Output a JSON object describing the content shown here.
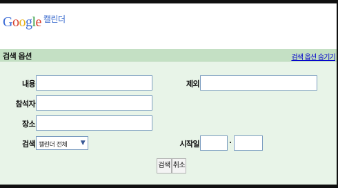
{
  "logo": {
    "letters": [
      {
        "ch": "G",
        "color": "#3b6bd6"
      },
      {
        "ch": "o",
        "color": "#d84030"
      },
      {
        "ch": "o",
        "color": "#e8b018"
      },
      {
        "ch": "g",
        "color": "#3b6bd6"
      },
      {
        "ch": "l",
        "color": "#2f9a3c"
      },
      {
        "ch": "e",
        "color": "#d84030"
      }
    ],
    "product": "캘린더"
  },
  "section": {
    "title": "검색 옵션",
    "hide_link": "검색 옵션 숨기기"
  },
  "form": {
    "content_label": "내용",
    "exclude_label": "제외",
    "attendee_label": "참석자",
    "location_label": "장소",
    "search_label": "검색",
    "search_scope_value": "캘린더 전체",
    "start_label": "시작일"
  },
  "buttons": {
    "search": "검색",
    "cancel": "취소"
  },
  "colors": {
    "bar_bg": "#c4e0c4",
    "panel_bg": "#e8f4e8",
    "link": "#0000cc"
  }
}
